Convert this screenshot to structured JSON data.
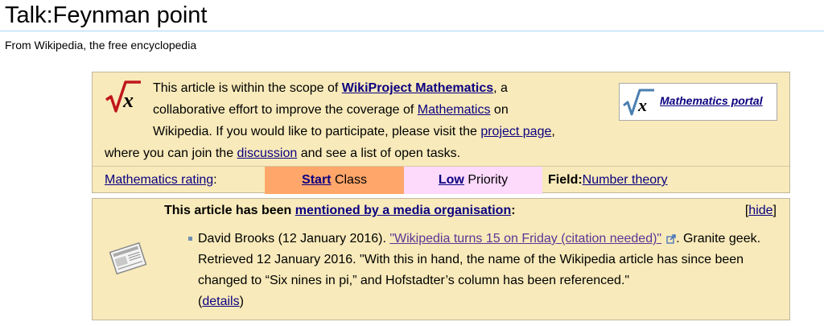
{
  "page": {
    "title": "Talk:Feynman point",
    "tagline": "From Wikipedia, the free encyclopedia"
  },
  "wikiproject": {
    "text1": "This article is within the scope of ",
    "project_link": "WikiProject Mathematics",
    "text2": ", a",
    "text3": "collaborative effort to improve the coverage of ",
    "math_link": "Mathematics",
    "text4": " on",
    "text5": "Wikipedia. If you would like to participate, please visit the ",
    "project_page_link": "project page",
    "text6": ",",
    "text7": "where you can join the ",
    "discussion_link": "discussion",
    "text8": " and see a list of open tasks.",
    "portal_label": "Mathematics portal",
    "rating_link": "Mathematics rating",
    "rating_colon": ":",
    "class_link": "Start",
    "class_suffix": " Class",
    "priority_link": "Low",
    "priority_suffix": " Priority",
    "field_label": "Field",
    "field_colon": ":",
    "field_link": "Number theory",
    "class_color": "#ffa66a",
    "priority_color": "#fdd9fb",
    "banner_color": "#f8eaba"
  },
  "media": {
    "heading_prefix": "This article has been ",
    "heading_link": "mentioned by a media organisation",
    "heading_suffix": ":",
    "hide_open": "[",
    "hide_link": "hide",
    "hide_close": "]",
    "entry_author": "David Brooks (12 January 2016). ",
    "entry_title_link": "\"Wikipedia turns 15 on Friday (citation needed)\"",
    "entry_text1": ". Granite geek. Retrieved 12 January 2016. \"With this in hand, the name of the Wikipedia article has since been changed to “Six nines in pi,” and Hofstadter’s column has been referenced.\"",
    "details_open": "(",
    "details_link": "details",
    "details_close": ")"
  },
  "icons": {
    "math": "sqrt-x-icon",
    "portal": "sqrt-x-icon",
    "newspaper": "newspaper-icon",
    "external": "external-link-icon"
  }
}
